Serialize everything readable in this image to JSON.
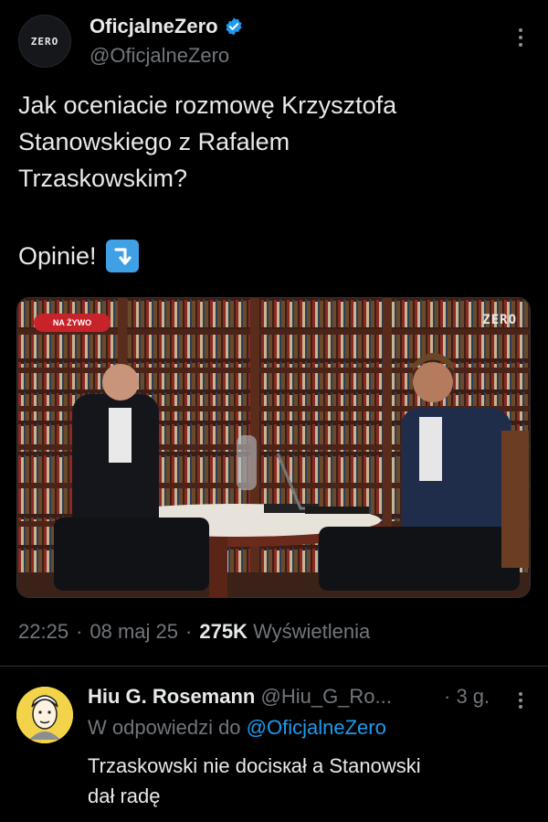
{
  "author": {
    "display_name": "OficjalneZero",
    "handle": "@OficjalneZero",
    "avatar_text": "ZERO",
    "verified_icon": "verified-badge-icon"
  },
  "tweet": {
    "lines": [
      "Jak oceniacie rozmowę Krzysztofa",
      "Stanowskiego z Rafalem",
      "Trzaskowskim?"
    ],
    "opinie": "Opinie!",
    "emoji": "arrow-down-right-emoji"
  },
  "media": {
    "live_badge": "NA ŻYWO",
    "logo": "ZERO"
  },
  "meta": {
    "time": "22:25",
    "date": "08 maj 25",
    "views_count": "275K",
    "views_label": "Wyświetlenia",
    "sep": "·"
  },
  "reply": {
    "name": "Hiu G. Rosemann",
    "handle": "@Hiu_G_Ro...",
    "time": "· 3 g.",
    "reply_to_label": "W odpowiedzi do",
    "reply_to_handle": "@OficjalneZero",
    "text_line1": "Trzaskowski nie docisкał a Stanowski",
    "text_line2": "dał  radę"
  },
  "colors": {
    "background": "#000000",
    "link": "#1d9bf0",
    "muted": "#71767b",
    "verified": "#1d9bf0",
    "live": "#c8232b"
  }
}
